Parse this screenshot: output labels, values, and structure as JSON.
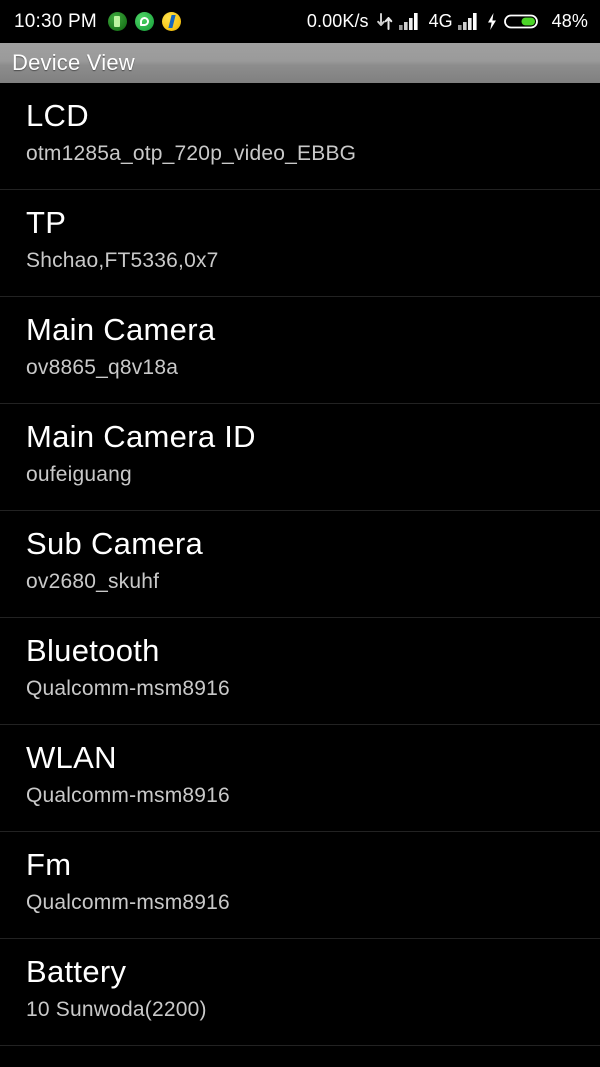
{
  "statusbar": {
    "clock": "10:30 PM",
    "notification_icons": [
      {
        "name": "battery-saver-icon",
        "label": "battery-saver"
      },
      {
        "name": "whatsapp-icon",
        "label": "whatsapp"
      },
      {
        "name": "flipkart-icon",
        "label": "flipkart"
      }
    ],
    "network_speed": "0.00K/s",
    "data_arrows_icon": "data-transfer-icon",
    "signal_icon_1": "signal-bars-icon",
    "network_type": "4G",
    "signal_icon_2": "signal-bars-icon",
    "charging_icon": "charging-bolt-icon",
    "battery_icon": "battery-icon",
    "battery_percent": "48%",
    "battery_fill_color": "#4cd428",
    "text_color": "#ffffff",
    "background": "#000000"
  },
  "titlebar": {
    "title": "Device View",
    "gradient_top": "#a0a0a0",
    "gradient_bottom": "#808080",
    "text_color": "#ffffff"
  },
  "list": {
    "title_color": "#ffffff",
    "subtitle_color": "#c9c9c9",
    "divider_color": "#222222",
    "rows": [
      {
        "title": "LCD",
        "subtitle": "otm1285a_otp_720p_video_EBBG"
      },
      {
        "title": "TP",
        "subtitle": "Shchao,FT5336,0x7"
      },
      {
        "title": "Main Camera",
        "subtitle": "ov8865_q8v18a"
      },
      {
        "title": "Main Camera ID",
        "subtitle": "oufeiguang"
      },
      {
        "title": "Sub Camera",
        "subtitle": "ov2680_skuhf"
      },
      {
        "title": "Bluetooth",
        "subtitle": "Qualcomm-msm8916"
      },
      {
        "title": "WLAN",
        "subtitle": "Qualcomm-msm8916"
      },
      {
        "title": "Fm",
        "subtitle": "Qualcomm-msm8916"
      },
      {
        "title": "Battery",
        "subtitle": "10 Sunwoda(2200)"
      }
    ]
  }
}
